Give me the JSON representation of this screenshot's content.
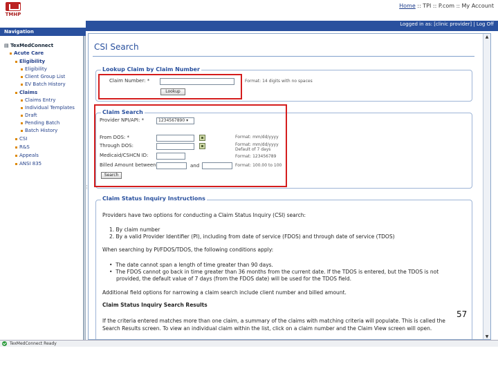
{
  "header": {
    "logo_text": "TMHP",
    "links": [
      "Home",
      "TPI",
      "P.com",
      "My Account"
    ],
    "user_info": "Logged in as: [clinic provider] | Log Off"
  },
  "nav": {
    "title": "Navigation",
    "root": "TexMedConnect",
    "items": [
      {
        "label": "Acute Care"
      },
      {
        "label": "Eligibility"
      },
      {
        "label": "Eligibility"
      },
      {
        "label": "Client Group List"
      },
      {
        "label": "EV Batch History"
      },
      {
        "label": "Claims"
      },
      {
        "label": "Claims Entry"
      },
      {
        "label": "Individual Templates"
      },
      {
        "label": "Draft"
      },
      {
        "label": "Pending Batch"
      },
      {
        "label": "Batch History"
      },
      {
        "label": "CSI"
      },
      {
        "label": "R&S"
      },
      {
        "label": "Appeals"
      },
      {
        "label": "ANSI 835"
      }
    ]
  },
  "main": {
    "title": "CSI Search",
    "lookup": {
      "legend": "Lookup Claim by Claim Number",
      "claim_label": "Claim Number: *",
      "claim_value": "",
      "hint": "Format: 14 digits with no spaces",
      "button": "Lookup"
    },
    "search": {
      "legend": "Claim Search",
      "provider_label": "Provider NPI/API: *",
      "provider_value": "1234567890",
      "from_label": "From DOS: *",
      "from_hint": "Format: mm/dd/yyyy",
      "through_label": "Through DOS:",
      "through_hint_1": "Format: mm/dd/yyyy",
      "through_hint_2": "Default of 7 days",
      "medicaid_label": "Medicaid/CSHCN ID:",
      "medicaid_hint": "Format: 123456789",
      "billed_label": "Billed Amount between",
      "and_label": "and",
      "billed_hint": "Format: 100.00 to 100",
      "button": "Search"
    },
    "instructions": {
      "legend": "Claim Status Inquiry Instructions",
      "p1": "Providers have two options for conducting a Claim Status Inquiry (CSI) search:",
      "o1": "1.  By claim number",
      "o2": "2.  By a valid Provider Identifier (PI), including from date of service (FDOS) and through date of service (TDOS)",
      "p2": "When searching by PI/FDOS/TDOS, the following conditions apply:",
      "b1": "The date cannot span a length of time greater than 90 days.",
      "b2a": "The FDOS cannot go back in time greater than 36 months from the current date. If the TDOS is entered, but the TDOS is not",
      "b2b": "provided, the default value of 7 days (from the FDOS date) will be used for the TDOS field.",
      "p3": "Additional field options for narrowing a claim search include client number and billed amount.",
      "h2": "Claim Status Inquiry Search Results",
      "p4a": "If the criteria entered matches more than one claim, a summary of the claims with matching criteria will populate. This is called the",
      "p4b": "Search Results screen. To view an individual claim within the list, click on a claim number and the Claim View screen will open."
    }
  },
  "status": "TexMedConnect Ready",
  "page_number": "57"
}
